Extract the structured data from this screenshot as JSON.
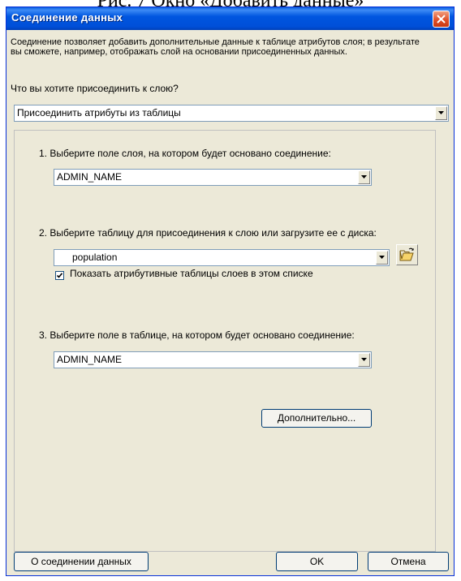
{
  "caption": "Рис. 7 Окно «Добавить данные»",
  "dialog": {
    "title": "Соединение данных",
    "close_icon": "close-x-icon",
    "description": "Соединение позволяет добавить дополнительные данные к таблице атрибутов слоя; в результате вы сможете, например, отображать слой на основании присоединенных данных.",
    "question": "Что вы хотите присоединить к слою?",
    "join_type": "Присоединить атрибуты из таблицы",
    "step1": {
      "label": "1. Выберите поле слоя, на котором будет основано соединение:",
      "value": "ADMIN_NAME"
    },
    "step2": {
      "label": "2. Выберите таблицу для присоединения к слою или загрузите ее с диска:",
      "value": "population",
      "browse_icon": "open-folder-icon",
      "checkbox_label": "Показать атрибутивные таблицы слоев в этом списке",
      "checkbox_checked": true
    },
    "step3": {
      "label": "3. Выберите поле в таблице, на котором будет основано соединение:",
      "value": "ADMIN_NAME"
    },
    "advanced_button": "Дополнительно...",
    "about_button": "О соединении данных",
    "ok_button": "OK",
    "cancel_button": "Отмена"
  }
}
